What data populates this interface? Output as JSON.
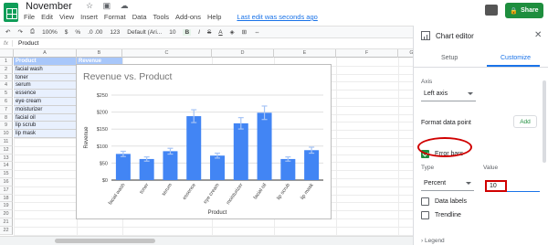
{
  "doc": {
    "title": "November"
  },
  "menu": [
    "File",
    "Edit",
    "View",
    "Insert",
    "Format",
    "Data",
    "Tools",
    "Add-ons",
    "Help"
  ],
  "last_edit": "Last edit was seconds ago",
  "share_label": "Share",
  "toolbar": {
    "zoom": "100%",
    "currency": "$",
    "percent": "%",
    "decimals": ".0  .00",
    "number_format": "123",
    "font": "Default (Ari...",
    "font_size": "10",
    "bold": "B",
    "italic": "I",
    "strike": "S",
    "text_color": "A"
  },
  "formula_bar": {
    "fx": "fx",
    "value": "Product"
  },
  "columns": [
    "A",
    "B",
    "C",
    "D",
    "E",
    "F",
    "G"
  ],
  "rows": [
    "1",
    "2",
    "3",
    "4",
    "5",
    "6",
    "7",
    "8",
    "9",
    "10",
    "11",
    "12",
    "13",
    "14",
    "15",
    "16",
    "17",
    "18",
    "19",
    "20",
    "21",
    "22"
  ],
  "table": {
    "headers": [
      "Product",
      "Revenue"
    ],
    "products": [
      "facial wash",
      "toner",
      "serum",
      "essence",
      "eye cream",
      "moisturizer",
      "facial oil",
      "lip scrub",
      "lip mask"
    ]
  },
  "chart_data": {
    "type": "bar",
    "title": "Revenue vs. Product",
    "xlabel": "Product",
    "ylabel": "Revenue",
    "categories": [
      "facial wash",
      "toner",
      "serum",
      "essence",
      "eye cream",
      "moisturizer",
      "facial oil",
      "lip scrub",
      "lip mask"
    ],
    "values": [
      77,
      62,
      85,
      188,
      72,
      167,
      198,
      62,
      88
    ],
    "error_bars": {
      "type": "percent",
      "value": 10
    },
    "ylim": [
      0,
      250
    ],
    "yticks": [
      "$0",
      "$50",
      "$100",
      "$150",
      "$200",
      "$250"
    ],
    "color": "#4285f4",
    "grid": true
  },
  "panel": {
    "title": "Chart editor",
    "tabs": [
      "Setup",
      "Customize"
    ],
    "axis_label": "Axis",
    "axis_value": "Left axis",
    "format_point": "Format data point",
    "add_label": "Add",
    "error_bars_label": "Error bars",
    "type_label": "Type",
    "type_value": "Percent",
    "value_label": "Value",
    "value_value": "10",
    "data_labels": "Data labels",
    "trendline": "Trendline",
    "legend_label": "Legend"
  }
}
